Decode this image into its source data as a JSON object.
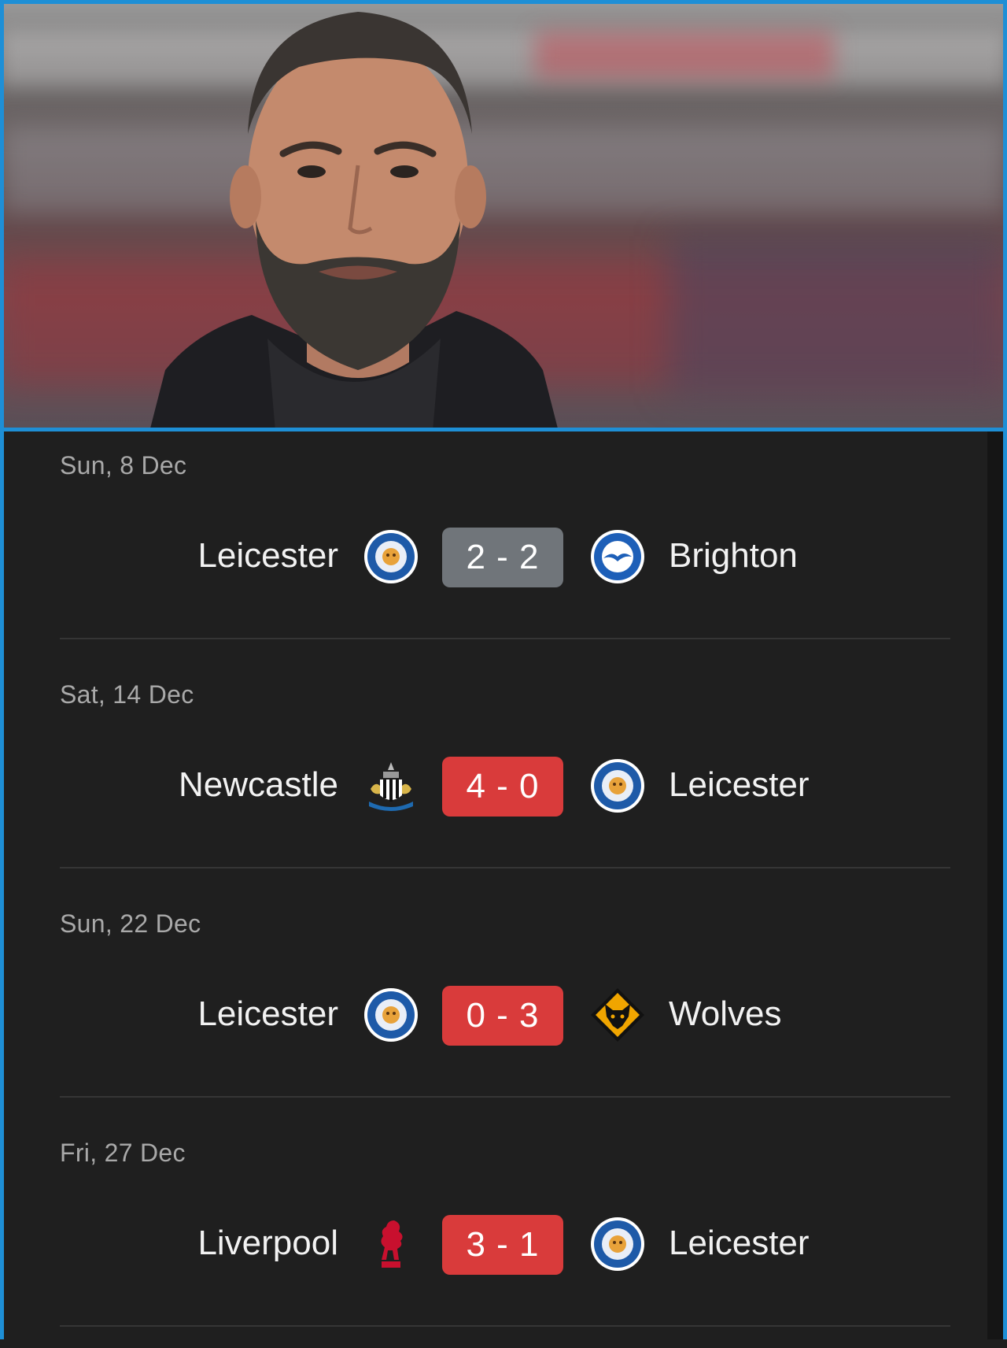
{
  "colors": {
    "frame": "#1e8fd6",
    "background": "#1f1f1f",
    "score_draw": "#70757a",
    "score_result": "#d93b3b",
    "date_text": "#a9a9a9",
    "team_text": "#f2f2f2"
  },
  "header_image": {
    "icon": "manager-photo"
  },
  "matches": [
    {
      "date": "Sun, 8 Dec",
      "home": "Leicester",
      "home_icon": "leicester-crest-icon",
      "score": "2 - 2",
      "away": "Brighton",
      "away_icon": "brighton-crest-icon",
      "result": "draw"
    },
    {
      "date": "Sat, 14 Dec",
      "home": "Newcastle",
      "home_icon": "newcastle-crest-icon",
      "score": "4 - 0",
      "away": "Leicester",
      "away_icon": "leicester-crest-icon",
      "result": "loss"
    },
    {
      "date": "Sun, 22 Dec",
      "home": "Leicester",
      "home_icon": "leicester-crest-icon",
      "score": "0 - 3",
      "away": "Wolves",
      "away_icon": "wolves-crest-icon",
      "result": "loss"
    },
    {
      "date": "Fri, 27 Dec",
      "home": "Liverpool",
      "home_icon": "liverpool-crest-icon",
      "score": "3 - 1",
      "away": "Leicester",
      "away_icon": "leicester-crest-icon",
      "result": "loss"
    }
  ]
}
